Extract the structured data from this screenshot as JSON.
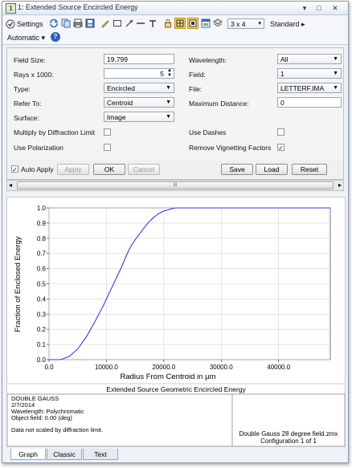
{
  "window": {
    "title": "1: Extended Source Encircled Energy",
    "pin_glyph": "▾",
    "close_glyph": "✕",
    "max_glyph": "□"
  },
  "toolbar": {
    "settings_label": "Settings",
    "layout_label": "3 x 4",
    "standard_label": "Standard",
    "automatic_label": "Automatic",
    "help_glyph": "?"
  },
  "settings": {
    "field_size_label": "Field Size:",
    "field_size_value": "19.799",
    "rays_label": "Rays x 1000:",
    "rays_value": "5",
    "type_label": "Type:",
    "type_value": "Encircled",
    "refer_label": "Refer To:",
    "refer_value": "Centroid",
    "surface_label": "Surface:",
    "surface_value": "Image",
    "multiply_label": "Multiply by Diffraction Limit",
    "polarization_label": "Use Polarization",
    "wavelength_label": "Wavelength:",
    "wavelength_value": "All",
    "field_label": "Field:",
    "field_value": "1",
    "file_label": "File:",
    "file_value": "LETTERF.IMA",
    "maxdist_label": "Maximum Distance:",
    "maxdist_value": "0",
    "dashes_label": "Use Dashes",
    "vignetting_label": "Remove Vignetting Factors",
    "vignetting_checked": true,
    "check_glyph": "✓"
  },
  "buttons": {
    "auto_apply": "Auto Apply",
    "apply": "Apply",
    "ok": "OK",
    "cancel": "Cancel",
    "save": "Save",
    "load": "Load",
    "reset": "Reset"
  },
  "scrollbar": {
    "left_glyph": "◂",
    "right_glyph": "▸",
    "grip_glyph": "III"
  },
  "chart_data": {
    "type": "line",
    "xlabel": "Radius From Centroid in µm",
    "ylabel": "Fraction of Enclosed Energy",
    "xlim": [
      0,
      49000
    ],
    "ylim": [
      0,
      1.0
    ],
    "x_ticks": [
      0,
      10000,
      20000,
      30000,
      40000
    ],
    "x_tick_labels": [
      "0.0",
      "10000.0",
      "20000.0",
      "30000.0",
      "40000.0"
    ],
    "y_ticks": [
      0,
      0.1,
      0.2,
      0.3,
      0.4,
      0.5,
      0.6,
      0.7,
      0.8,
      0.9,
      1.0
    ],
    "y_tick_labels": [
      "0.0",
      "0.1",
      "0.2",
      "0.3",
      "0.4",
      "0.5",
      "0.6",
      "0.7",
      "0.8",
      "0.9",
      "1.0"
    ],
    "grid": true,
    "series": [
      {
        "color": "#3a3ad8",
        "x": [
          0,
          2000,
          3500,
          5000,
          6500,
          8000,
          9500,
          11000,
          12500,
          14000,
          15000,
          16000,
          17000,
          18000,
          19000,
          20000,
          21000,
          22000,
          24000,
          30000,
          40000,
          49000
        ],
        "y": [
          0.0,
          0.0,
          0.02,
          0.07,
          0.15,
          0.25,
          0.36,
          0.48,
          0.6,
          0.73,
          0.79,
          0.84,
          0.89,
          0.93,
          0.96,
          0.98,
          0.99,
          1.0,
          1.0,
          1.0,
          1.0,
          1.0
        ]
      }
    ],
    "footer_title": "Extended Source Geometric Encircled Energy"
  },
  "info": {
    "line1": "DOUBLE GAUSS",
    "line2": "2/7/2014",
    "line3": "Wavelength: Polychromatic",
    "line4": "Object field: 0.00 (deg)",
    "note": "Data not scaled by diffraction limit.",
    "file_line1": "Double Gauss 28 degree field.zmx",
    "file_line2": "Configuration 1 of 1"
  },
  "tabs": [
    "Graph",
    "Classic",
    "Text"
  ]
}
